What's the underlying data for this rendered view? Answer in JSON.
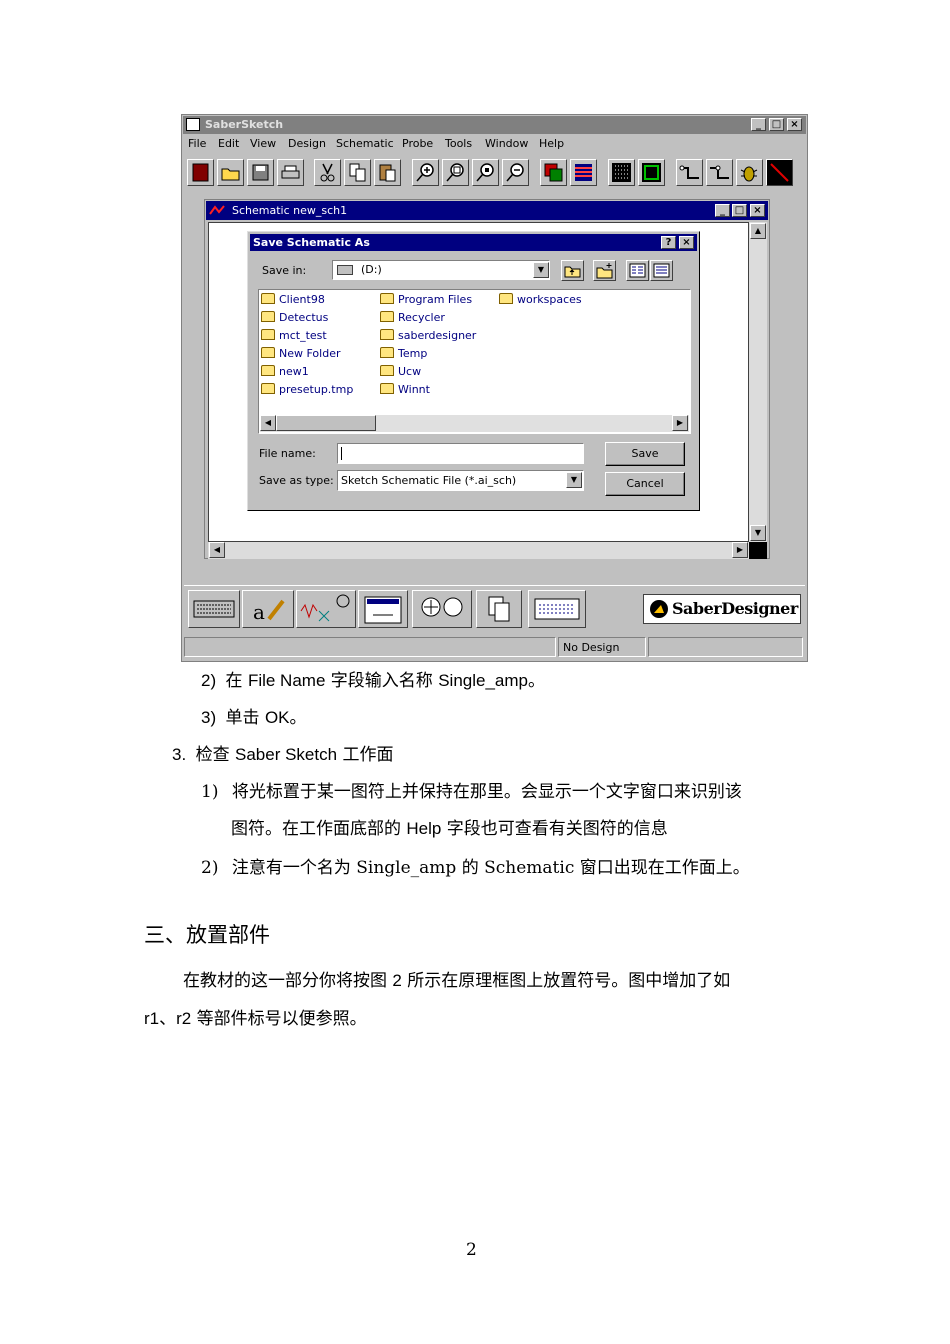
{
  "app": {
    "title": "SaberSketch",
    "menu": [
      "File",
      "Edit",
      "View",
      "Design",
      "Schematic",
      "Probe",
      "Tools",
      "Window",
      "Help"
    ],
    "toolbar_icons": [
      "new-icon",
      "open-icon",
      "save-icon",
      "print-icon",
      "cut-icon",
      "copy-icon",
      "paste-icon",
      "zoom-in-icon",
      "zoom-fit-icon",
      "zoom-area-icon",
      "zoom-out-icon",
      "layers-icon",
      "netlist-icon",
      "grid-icon",
      "symbol-icon",
      "wire-icon",
      "probe-icon",
      "bug-icon",
      "pen-icon"
    ],
    "schematic_window": {
      "title": "Schematic new_sch1"
    },
    "dialog": {
      "title": "Save Schematic As",
      "save_in_label": "Save in:",
      "save_in_value": "(D:)",
      "files": {
        "col1": [
          "Client98",
          "Detectus",
          "mct_test",
          "New Folder",
          "new1",
          "presetup.tmp"
        ],
        "col2": [
          "Program Files",
          "Recycler",
          "saberdesigner",
          "Temp",
          "Ucw",
          "Winnt"
        ],
        "col3": [
          "workspaces"
        ]
      },
      "file_name_label": "File name:",
      "file_name_value": "",
      "save_as_type_label": "Save as type:",
      "save_as_type_value": "Sketch Schematic File (*.ai_sch)",
      "save_button": "Save",
      "cancel_button": "Cancel"
    },
    "bottom_toolbar": {
      "logo_text": "SaberDesigner"
    },
    "status": {
      "design": "No Design"
    }
  },
  "doc": {
    "step2": {
      "num": "2)",
      "pre": "在 ",
      "a": "File Name",
      "mid": " 字段输入名称 ",
      "b": "Single_amp",
      "post": "。"
    },
    "step3": {
      "num": "3)",
      "pre": "单击 ",
      "a": "OK",
      "post": "。"
    },
    "section3": {
      "num": "3.",
      "pre": "检查 ",
      "a": "Saber Sketch",
      "post": " 工作面"
    },
    "item1_line1": "将光标置于某一图符上并保持在那里。会显示一个文字窗口来识别该",
    "item1_num": "1)",
    "item1_line2_pre": "图符。在工作面底部的 ",
    "item1_line2_a": "Help",
    "item1_line2_post": " 字段也可查看有关图符的信息",
    "item2_num": "2)",
    "item2_text": "注意有一个名为 Single_amp 的 Schematic 窗口出现在工作面上。",
    "heading": "三、放置部件",
    "para_line1_pre": "在教材的这一部分你将按图 ",
    "para_line1_a": "2",
    "para_line1_post": " 所示在原理框图上放置符号。图中增加了如",
    "para_line2_a": "r1、r2",
    "para_line2_post": " 等部件标号以便参照。",
    "page_number": "2"
  }
}
